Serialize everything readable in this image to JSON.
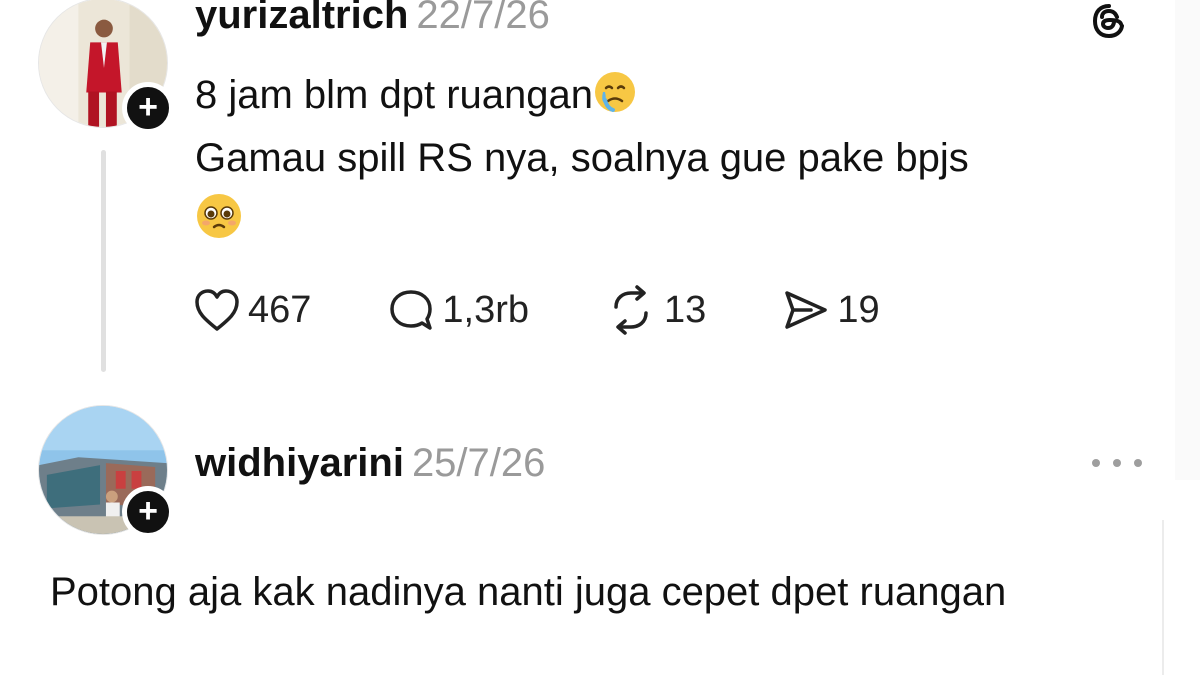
{
  "posts": [
    {
      "username": "yurizaltrich",
      "date": "22/7/26",
      "text_line1": "8 jam blm dpt ruangan",
      "text_line2": "Gamau spill RS nya, soalnya gue pake bpjs",
      "emoji1": "crying-face-emoji",
      "emoji2": "pleading-face-emoji",
      "follow_symbol": "+",
      "actions": {
        "likes": "467",
        "comments": "1,3rb",
        "reposts": "13",
        "shares": "19"
      }
    },
    {
      "username": "widhiyarini",
      "date": "25/7/26",
      "text": "Potong aja kak nadinya nanti juga cepet dpet ruangan",
      "follow_symbol": "+"
    }
  ],
  "icons": {
    "threads_logo": "threads-logo-icon",
    "more": "more-options-icon",
    "like": "heart-icon",
    "comment": "comment-icon",
    "repost": "repost-icon",
    "share": "send-icon"
  },
  "colors": {
    "text": "#111111",
    "muted": "#9a9a9a",
    "thread_line": "#e0e0e0",
    "badge": "#111111"
  }
}
